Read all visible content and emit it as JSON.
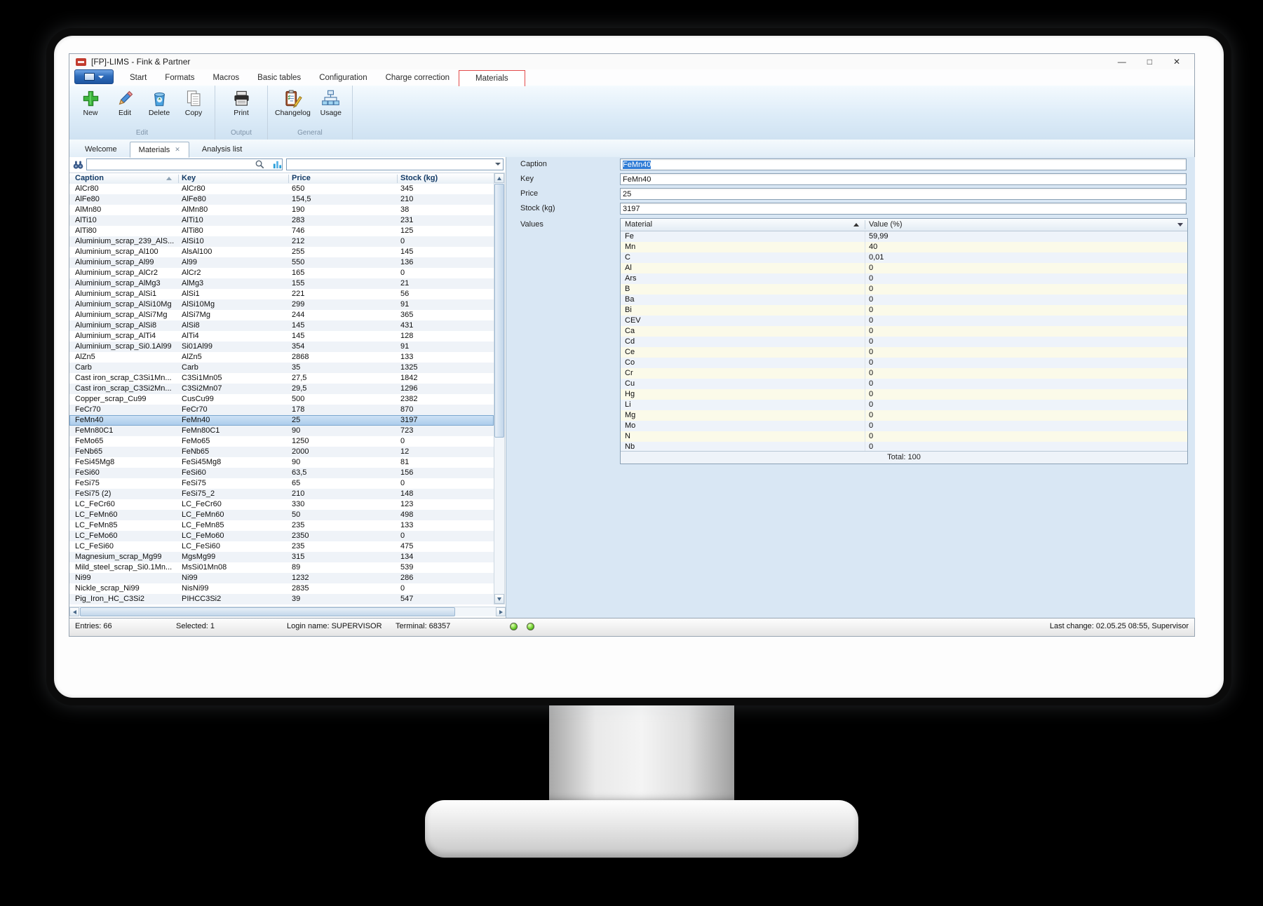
{
  "window": {
    "title": "[FP]-LIMS - Fink & Partner",
    "controls": {
      "minimize": "—",
      "maximize": "□",
      "close": "✕"
    }
  },
  "colors": {
    "accent_red": "#e24a4a",
    "selection_blue": "#2f7cd6",
    "row_highlight": "#a9cbeb",
    "led_green": "#72d22f",
    "ribbon_blue": "#2f6cbb"
  },
  "icons": {
    "app": "fp-red-logo",
    "new": "green-plus",
    "edit": "pencil",
    "delete": "recycle-bin",
    "copy": "two-pages",
    "print": "printer",
    "changelog": "clipboard-pencil",
    "usage": "org-tree",
    "find": "binoculars",
    "search": "magnifier",
    "columns": "blue-columns"
  },
  "ribbon": {
    "tabs": [
      "Start",
      "Formats",
      "Macros",
      "Basic tables",
      "Configuration",
      "Charge correction"
    ],
    "active_tab": "Materials",
    "buttons": [
      {
        "label": "New"
      },
      {
        "label": "Edit"
      },
      {
        "label": "Delete"
      },
      {
        "label": "Copy"
      },
      {
        "label": "Print"
      },
      {
        "label": "Changelog"
      },
      {
        "label": "Usage"
      }
    ],
    "groups": [
      "Edit",
      "Output",
      "General"
    ]
  },
  "doc_tabs": {
    "items": [
      "Welcome",
      "Materials",
      "Analysis list"
    ],
    "active": "Materials"
  },
  "search": {
    "find_value": "",
    "filter_value": ""
  },
  "list": {
    "columns": [
      "Caption",
      "Key",
      "Price",
      "Stock (kg)"
    ],
    "selected_caption": "FeMn40",
    "rows": [
      [
        "AlCr80",
        "AlCr80",
        "650",
        "345"
      ],
      [
        "AlFe80",
        "AlFe80",
        "154,5",
        "210"
      ],
      [
        "AlMn80",
        "AlMn80",
        "190",
        "38"
      ],
      [
        "AlTi10",
        "AlTi10",
        "283",
        "231"
      ],
      [
        "AlTi80",
        "AlTi80",
        "746",
        "125"
      ],
      [
        "Aluminium_scrap_239_AlS...",
        "AlSi10",
        "212",
        "0"
      ],
      [
        "Aluminium_scrap_Al100",
        "AlsAl100",
        "255",
        "145"
      ],
      [
        "Aluminium_scrap_Al99",
        "Al99",
        "550",
        "136"
      ],
      [
        "Aluminium_scrap_AlCr2",
        "AlCr2",
        "165",
        "0"
      ],
      [
        "Aluminium_scrap_AlMg3",
        "AlMg3",
        "155",
        "21"
      ],
      [
        "Aluminium_scrap_AlSi1",
        "AlSi1",
        "221",
        "56"
      ],
      [
        "Aluminium_scrap_AlSi10Mg",
        "AlSi10Mg",
        "299",
        "91"
      ],
      [
        "Aluminium_scrap_AlSi7Mg",
        "AlSi7Mg",
        "244",
        "365"
      ],
      [
        "Aluminium_scrap_AlSi8",
        "AlSi8",
        "145",
        "431"
      ],
      [
        "Aluminium_scrap_AlTi4",
        "AlTi4",
        "145",
        "128"
      ],
      [
        "Aluminium_scrap_Si0.1Al99",
        "Si01Al99",
        "354",
        "91"
      ],
      [
        "AlZn5",
        "AlZn5",
        "2868",
        "133"
      ],
      [
        "Carb",
        "Carb",
        "35",
        "1325"
      ],
      [
        "Cast iron_scrap_C3Si1Mn...",
        "C3Si1Mn05",
        "27,5",
        "1842"
      ],
      [
        "Cast iron_scrap_C3Si2Mn...",
        "C3Si2Mn07",
        "29,5",
        "1296"
      ],
      [
        "Copper_scrap_Cu99",
        "CusCu99",
        "500",
        "2382"
      ],
      [
        "FeCr70",
        "FeCr70",
        "178",
        "870"
      ],
      [
        "FeMn40",
        "FeMn40",
        "25",
        "3197"
      ],
      [
        "FeMn80C1",
        "FeMn80C1",
        "90",
        "723"
      ],
      [
        "FeMo65",
        "FeMo65",
        "1250",
        "0"
      ],
      [
        "FeNb65",
        "FeNb65",
        "2000",
        "12"
      ],
      [
        "FeSi45Mg8",
        "FeSi45Mg8",
        "90",
        "81"
      ],
      [
        "FeSi60",
        "FeSi60",
        "63,5",
        "156"
      ],
      [
        "FeSi75",
        "FeSi75",
        "65",
        "0"
      ],
      [
        "FeSi75 (2)",
        "FeSi75_2",
        "210",
        "148"
      ],
      [
        "LC_FeCr60",
        "LC_FeCr60",
        "330",
        "123"
      ],
      [
        "LC_FeMn60",
        "LC_FeMn60",
        "50",
        "498"
      ],
      [
        "LC_FeMn85",
        "LC_FeMn85",
        "235",
        "133"
      ],
      [
        "LC_FeMo60",
        "LC_FeMo60",
        "2350",
        "0"
      ],
      [
        "LC_FeSi60",
        "LC_FeSi60",
        "235",
        "475"
      ],
      [
        "Magnesium_scrap_Mg99",
        "MgsMg99",
        "315",
        "134"
      ],
      [
        "Mild_steel_scrap_Si0.1Mn...",
        "MsSi01Mn08",
        "89",
        "539"
      ],
      [
        "Ni99",
        "Ni99",
        "1232",
        "286"
      ],
      [
        "Nickle_scrap_Ni99",
        "NisNi99",
        "2835",
        "0"
      ],
      [
        "Pig_Iron_HC_C3Si2",
        "PIHCC3Si2",
        "39",
        "547"
      ]
    ]
  },
  "details": {
    "fields": [
      {
        "label": "Caption",
        "value": "FeMn40"
      },
      {
        "label": "Key",
        "value": "FeMn40"
      },
      {
        "label": "Price",
        "value": "25"
      },
      {
        "label": "Stock (kg)",
        "value": "3197"
      }
    ],
    "values_label": "Values",
    "values_table": {
      "columns": [
        "Material",
        "Value (%)"
      ],
      "rows": [
        [
          "Fe",
          "59,99"
        ],
        [
          "Mn",
          "40"
        ],
        [
          "C",
          "0,01"
        ],
        [
          "Al",
          "0"
        ],
        [
          "Ars",
          "0"
        ],
        [
          "B",
          "0"
        ],
        [
          "Ba",
          "0"
        ],
        [
          "Bi",
          "0"
        ],
        [
          "CEV",
          "0"
        ],
        [
          "Ca",
          "0"
        ],
        [
          "Cd",
          "0"
        ],
        [
          "Ce",
          "0"
        ],
        [
          "Co",
          "0"
        ],
        [
          "Cr",
          "0"
        ],
        [
          "Cu",
          "0"
        ],
        [
          "Hg",
          "0"
        ],
        [
          "Li",
          "0"
        ],
        [
          "Mg",
          "0"
        ],
        [
          "Mo",
          "0"
        ],
        [
          "N",
          "0"
        ],
        [
          "Nb",
          "0"
        ]
      ],
      "total": "Total: 100"
    }
  },
  "status_bar": {
    "entries": "Entries: 66",
    "selected": "Selected: 1",
    "login": "Login name: SUPERVISOR",
    "terminal": "Terminal: 68357",
    "last_change": "Last change: 02.05.25 08:55, Supervisor"
  }
}
